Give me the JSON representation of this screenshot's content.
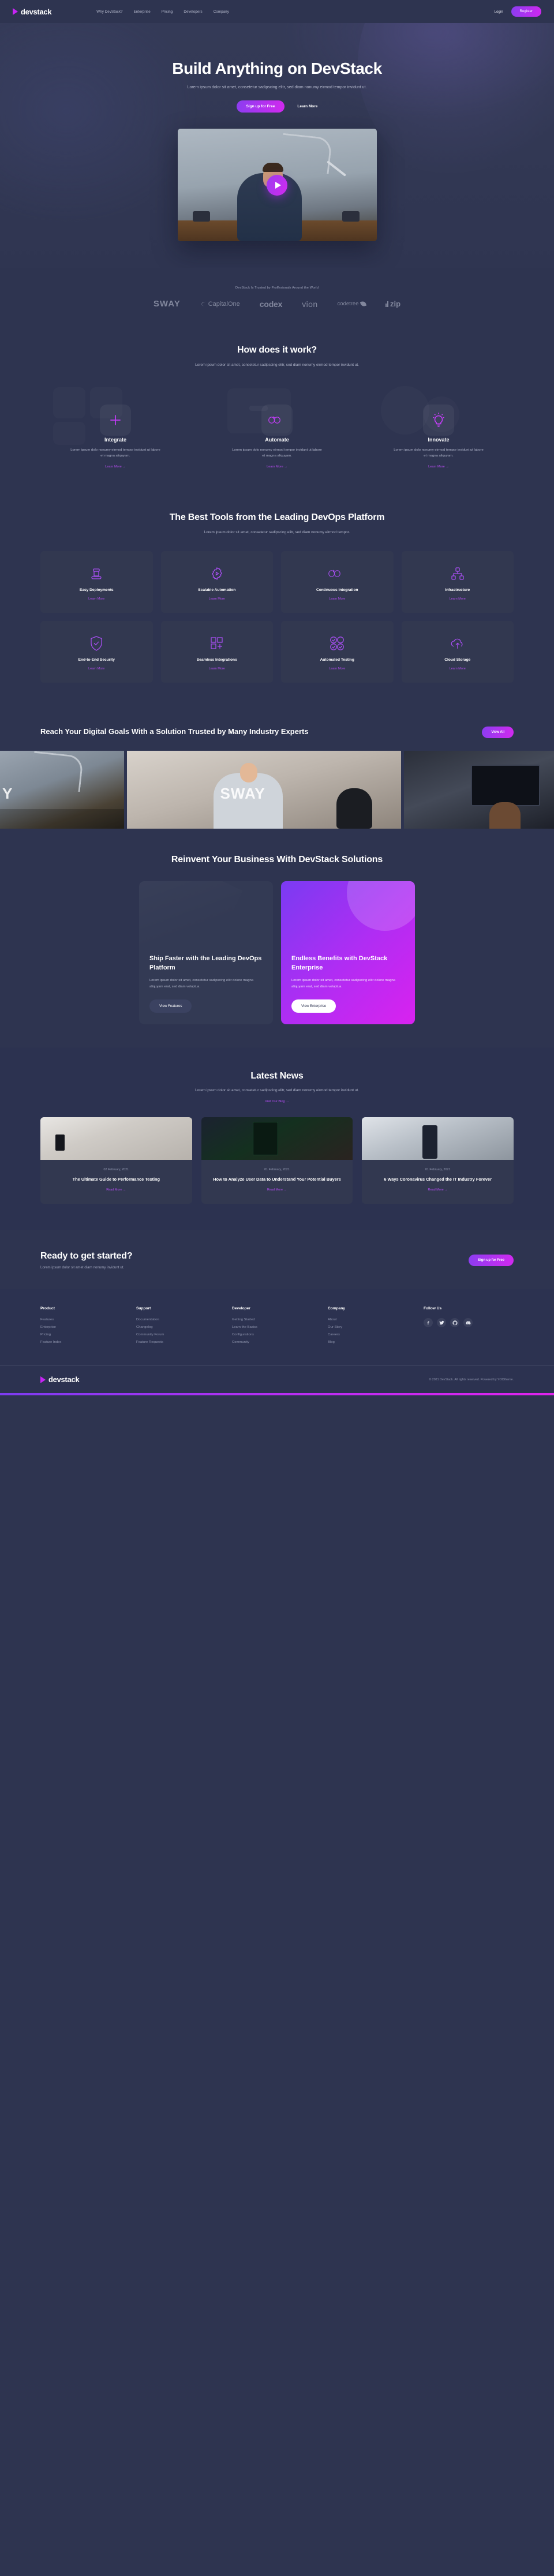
{
  "brand": {
    "name": "devstack",
    "logo_icon": "play-triangle-icon"
  },
  "header": {
    "nav": [
      {
        "label": "Why DevStack?"
      },
      {
        "label": "Enterprise"
      },
      {
        "label": "Pricing"
      },
      {
        "label": "Developers"
      },
      {
        "label": "Company"
      }
    ],
    "login_label": "Login",
    "register_label": "Register"
  },
  "hero": {
    "title": "Build Anything on DevStack",
    "subtitle": "Lorem ipsum dolor sit amet, consetetur sadipscing elitr, sed diam nonumy eirmod tempor invidunt ut.",
    "primary_cta": "Sign up for Free",
    "secondary_cta": "Learn More",
    "play_icon": "play-icon"
  },
  "logos": {
    "label": "DevStack Is Trusted by Proffesionals Around the World",
    "items": [
      {
        "name": "SWAY"
      },
      {
        "name": "CapitalOne"
      },
      {
        "name": "codex"
      },
      {
        "name": "vion"
      },
      {
        "name": "codetree"
      },
      {
        "name": "zip"
      }
    ]
  },
  "how": {
    "title": "How does it work?",
    "subtitle": "Lorem ipsum dolor sit amet, consetetur sadipscing elitr, sed diam nonumy eirmod tempor invidunt ut.",
    "cards": [
      {
        "name": "Integrate",
        "icon": "plus-icon",
        "desc": "Lorem ipsum dolo nonumy eirmod tempor invidunt ut labore et magna aliquyam.",
        "link": "Learn More →"
      },
      {
        "name": "Automate",
        "icon": "infinity-icon",
        "desc": "Lorem ipsum dolo nonumy eirmod tempor invidunt ut labore et magna aliquyam.",
        "link": "Learn More →"
      },
      {
        "name": "Innovate",
        "icon": "lightbulb-icon",
        "desc": "Lorem ipsum dolo nonumy eirmod tempor invidunt ut labore et magna aliquyam.",
        "link": "Learn More →"
      }
    ]
  },
  "tools": {
    "title": "The Best Tools from the Leading DevOps Platform",
    "subtitle": "Lorem ipsum dolor sit amet, consetetur sadipscing elitr, sed diam nonumy eirmod tempor.",
    "items": [
      {
        "name": "Easy Deployments",
        "icon": "conveyor-box-icon",
        "link": "Learn More"
      },
      {
        "name": "Scalable Automation",
        "icon": "gear-play-icon",
        "link": "Learn More"
      },
      {
        "name": "Continuous Integration",
        "icon": "infinity-icon",
        "link": "Learn More"
      },
      {
        "name": "Infrastructure",
        "icon": "sitemap-icon",
        "link": "Learn More"
      },
      {
        "name": "End-to-End Security",
        "icon": "shield-check-icon",
        "link": "Learn More"
      },
      {
        "name": "Seamless Integrations",
        "icon": "grid-plus-icon",
        "link": "Learn More"
      },
      {
        "name": "Automated Testing",
        "icon": "check-circles-icon",
        "link": "Learn More"
      },
      {
        "name": "Cloud Storage",
        "icon": "cloud-upload-icon",
        "link": "Learn More"
      }
    ]
  },
  "goals": {
    "title": "Reach Your Digital Goals With a Solution Trusted by Many Industry Experts",
    "cta": "View All",
    "gallery_overlay_left": "Y",
    "gallery_overlay_center": "SWAY"
  },
  "reinvent": {
    "title": "Reinvent Your Business With DevStack Solutions",
    "cards": [
      {
        "title": "Ship Faster with the Leading DevOps Platform",
        "desc": "Lorem ipsum dolor sit amet, consetetur sadipscing elitr dolore magna aliquyam erat, sed diam voluptua.",
        "cta": "View Features"
      },
      {
        "title": "Endless Benefits with DevStack Enterprise",
        "desc": "Lorem ipsum dolor sit amet, consetetur sadipscing elitr dolore magna aliquyam erat, sed diam voluptua.",
        "cta": "View Enterprise"
      }
    ]
  },
  "news": {
    "title": "Latest News",
    "subtitle": "Lorem ipsum dolor sit amet, consetetur sadipscing elitr, sed diam nonumy eirmod tempor invidunt ut.",
    "blog_link": "Visit Our Blog →",
    "items": [
      {
        "date": "02 February, 2021",
        "title": "The Ultimate Guide to Performance Testing",
        "read": "Read More →"
      },
      {
        "date": "01 February, 2021",
        "title": "How to Analyze User Data to Understand Your Potential Buyers",
        "read": "Read More →"
      },
      {
        "date": "01 February, 2021",
        "title": "6 Ways Coronavirus Changed the IT Industry Forever",
        "read": "Read More →"
      }
    ]
  },
  "cta": {
    "title": "Ready to get started?",
    "subtitle": "Lorem ipsum dolor sit amet diam nonumy invidunt ut.",
    "button": "Sign up for Free"
  },
  "footer": {
    "columns": [
      {
        "title": "Product",
        "links": [
          "Features",
          "Enterprise",
          "Pricing",
          "Feature Index"
        ]
      },
      {
        "title": "Support",
        "links": [
          "Documentation",
          "Changelog",
          "Community Forum",
          "Feature Requests"
        ]
      },
      {
        "title": "Developer",
        "links": [
          "Getting Started",
          "Learn the Basics",
          "Configurations",
          "Community"
        ]
      },
      {
        "title": "Company",
        "links": [
          "About",
          "Our Story",
          "Careers",
          "Blog"
        ]
      }
    ],
    "follow_title": "Follow Us",
    "socials": [
      {
        "icon": "facebook-icon"
      },
      {
        "icon": "twitter-icon"
      },
      {
        "icon": "github-icon"
      },
      {
        "icon": "discord-icon"
      }
    ],
    "copyright": "© 2021 DevStack. All rights reserved. Powered by YOOtheme."
  },
  "colors": {
    "bg": "#2e3450",
    "card": "#323850",
    "accent": "#b44df3",
    "grad_from": "#8b3df0",
    "grad_to": "#d229ef"
  }
}
